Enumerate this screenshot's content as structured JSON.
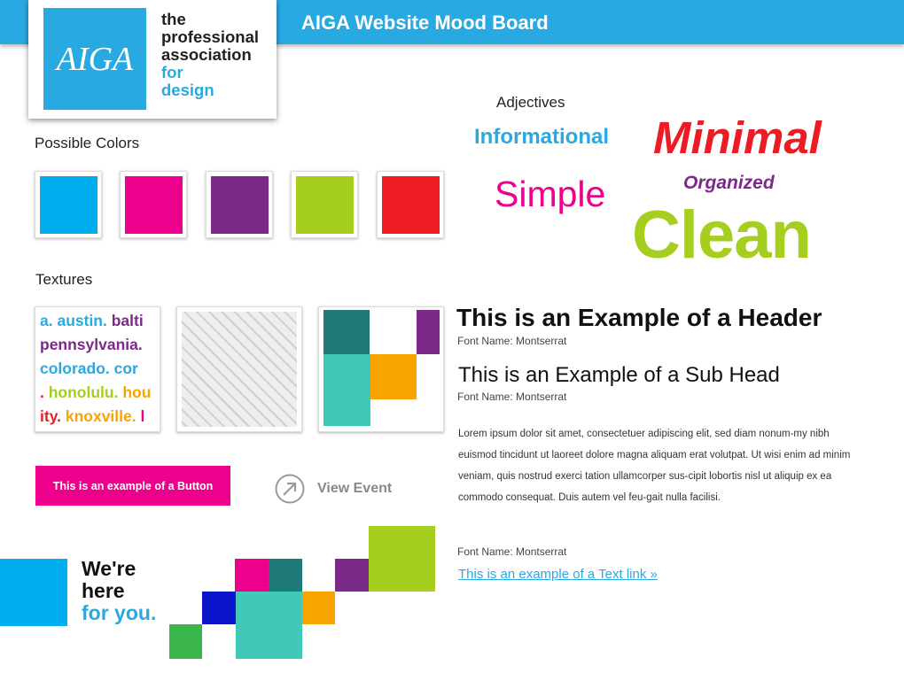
{
  "header": {
    "title": "AIGA Website Mood Board",
    "bar_color": "#29a9e1"
  },
  "logo": {
    "mark": "AIGA",
    "tagline": [
      {
        "text": "the",
        "tone": "dark"
      },
      {
        "text": "professional",
        "tone": "dark"
      },
      {
        "text": "association",
        "tone": "dark"
      },
      {
        "text": "for",
        "tone": "blue"
      },
      {
        "text": "design",
        "tone": "blue"
      }
    ]
  },
  "colors": {
    "label": "Possible Colors",
    "swatches": [
      "#00aeef",
      "#ec008c",
      "#7b2a8a",
      "#a6ce1e",
      "#ed1c24"
    ]
  },
  "textures": {
    "label": "Textures",
    "cities": [
      {
        "parts": [
          {
            "t": "a. austin. ",
            "c": "#29a9e1"
          },
          {
            "t": "balti",
            "c": "#7b2a8a"
          }
        ]
      },
      {
        "parts": [
          {
            "t": " pennsylvania.",
            "c": "#7b2a8a"
          }
        ]
      },
      {
        "parts": [
          {
            "t": " colorado. ",
            "c": "#29a9e1"
          },
          {
            "t": "cor",
            "c": "#29a9e1"
          }
        ]
      },
      {
        "parts": [
          {
            "t": ". ",
            "c": "#ed1c24"
          },
          {
            "t": "honolulu. ",
            "c": "#a6ce1e"
          },
          {
            "t": "hou",
            "c": "#f7a400"
          }
        ]
      },
      {
        "parts": [
          {
            "t": "ity. ",
            "c": "#ed1c24"
          },
          {
            "t": "knoxville. ",
            "c": "#f7a400"
          },
          {
            "t": "l",
            "c": "#ec008c"
          }
        ]
      }
    ]
  },
  "adjectives": {
    "label": "Adjectives",
    "words": [
      {
        "text": "Informational",
        "color": "#29a9e1"
      },
      {
        "text": "Minimal",
        "color": "#ed1c24"
      },
      {
        "text": "Simple",
        "color": "#ec008c"
      },
      {
        "text": "Organized",
        "color": "#7b2a8a"
      },
      {
        "text": "Clean",
        "color": "#a6ce1e"
      }
    ]
  },
  "button_example": {
    "label": "This is an example of a Button",
    "color": "#ec008c"
  },
  "view_event": {
    "label": "View Event"
  },
  "banner": {
    "line1": "We're",
    "line2": "here",
    "line3": "for you."
  },
  "typography": {
    "header": "This is an Example of a Header",
    "header_font": "Font Name: Montserrat",
    "subhead": "This is an Example of a Sub Head",
    "subhead_font": "Font Name: Montserrat",
    "body": "Lorem ipsum dolor sit amet, consectetuer adipiscing elit, sed diam nonum-my nibh euismod tincidunt ut laoreet dolore magna aliquam erat volutpat. Ut wisi enim ad minim veniam, quis nostrud exerci tation ullamcorper sus-cipit lobortis nisl ut aliquip ex ea commodo consequat. Duis autem vel feu-gait nulla facilisi.",
    "body_font": "Font Name: Montserrat",
    "text_link": "This is an example of a Text link »"
  }
}
